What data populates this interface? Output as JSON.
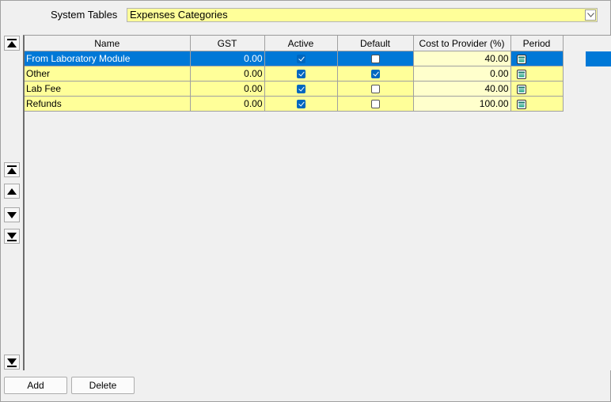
{
  "header": {
    "label": "System Tables",
    "selected_table": "Expenses Categories"
  },
  "grid": {
    "columns": [
      "Name",
      "GST",
      "Active",
      "Default",
      "Cost to Provider (%)",
      "Period"
    ],
    "rows": [
      {
        "name": "From Laboratory Module",
        "gst": "0.00",
        "active": true,
        "default": false,
        "cost": "40.00",
        "selected": true
      },
      {
        "name": "Other",
        "gst": "0.00",
        "active": true,
        "default": true,
        "cost": "0.00",
        "selected": false
      },
      {
        "name": "Lab Fee",
        "gst": "0.00",
        "active": true,
        "default": false,
        "cost": "40.00",
        "selected": false
      },
      {
        "name": "Refunds",
        "gst": "0.00",
        "active": true,
        "default": false,
        "cost": "100.00",
        "selected": false
      }
    ]
  },
  "nav": [
    "move-first-icon",
    "move-up-icon",
    "move-down-icon",
    "move-last-icon"
  ],
  "footer": {
    "add_label": "Add",
    "delete_label": "Delete"
  },
  "colors": {
    "row_bg": "#ffff99",
    "selection": "#0078d7",
    "cost_bg": "#ffffcc"
  }
}
